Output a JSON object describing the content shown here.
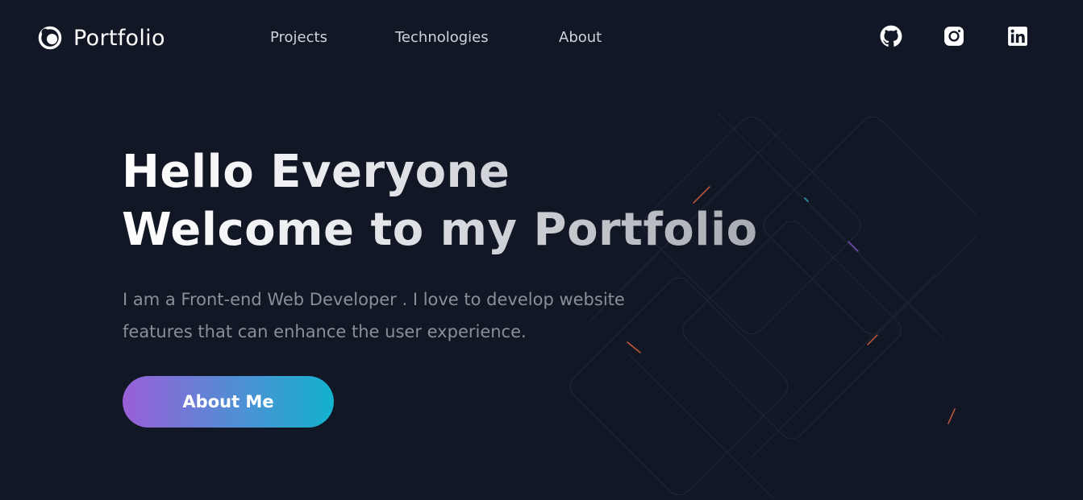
{
  "brand": {
    "name": "Portfolio",
    "icon": "portfolio-logo-icon"
  },
  "nav": {
    "items": [
      {
        "label": "Projects"
      },
      {
        "label": "Technologies"
      },
      {
        "label": "About"
      }
    ]
  },
  "social": [
    {
      "name": "github",
      "icon": "github-icon"
    },
    {
      "name": "instagram",
      "icon": "instagram-icon"
    },
    {
      "name": "linkedin",
      "icon": "linkedin-icon"
    }
  ],
  "hero": {
    "title_line1": "Hello Everyone",
    "title_line2": "Welcome to my Portfolio",
    "subtitle_line1": "I am a Front-end Web Developer . I love to develop website",
    "subtitle_line2": "features that can enhance the user experience.",
    "cta_label": "About Me"
  },
  "colors": {
    "background": "#111724",
    "cta_gradient_start": "#9a5fd8",
    "cta_gradient_end": "#13b2cd",
    "nav_text": "#cfd3dc",
    "subtitle_text": "#8b8f98"
  }
}
